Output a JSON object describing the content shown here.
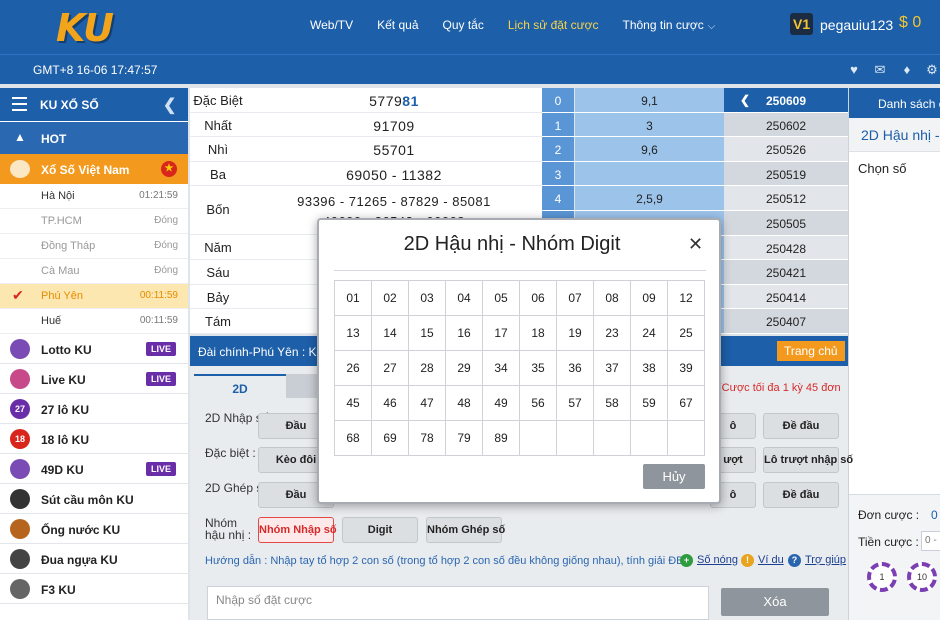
{
  "header": {
    "logo": "KU",
    "nav": [
      "Web/TV",
      "Kết quả",
      "Quy tắc",
      "Lịch sử đặt cược",
      "Thông tin cược"
    ],
    "vip": "V1",
    "username": "pegauiu123",
    "balance": "$ 0",
    "clock": "GMT+8 16-06 17:47:57",
    "accent": "#1d5fa8",
    "active_nav_color": "#f7d34a"
  },
  "sidebar": {
    "title": "KU XỔ SỐ",
    "hot": "HOT",
    "vn": "Xổ Số Việt Nam",
    "provinces": [
      {
        "name": "Hà Nội",
        "status": "01:21:59"
      },
      {
        "name": "TP.HCM",
        "status": "Đóng"
      },
      {
        "name": "Đồng Tháp",
        "status": "Đóng"
      },
      {
        "name": "Cà Mau",
        "status": "Đóng"
      },
      {
        "name": "Phú Yên",
        "status": "00:11:59"
      },
      {
        "name": "Huế",
        "status": "00:11:59"
      }
    ],
    "games": [
      {
        "name": "Lotto KU",
        "live": "LIVE",
        "icon": "lotto-icon",
        "color": "#7b4bb5"
      },
      {
        "name": "Live KU",
        "live": "LIVE",
        "icon": "live-host-icon",
        "color": "#c8498a"
      },
      {
        "name": "27 lô KU",
        "badge": "27",
        "icon": "ball-27-icon",
        "color": "#6a2da8"
      },
      {
        "name": "18 lô KU",
        "badge": "18",
        "icon": "ball-18-icon",
        "color": "#d8261c"
      },
      {
        "name": "49D KU",
        "live": "LIVE",
        "icon": "49d-icon",
        "color": "#7b4bb5"
      },
      {
        "name": "Sút cầu môn KU",
        "icon": "soccer-icon",
        "color": "#333333"
      },
      {
        "name": "Ống nước KU",
        "icon": "pipe-icon",
        "color": "#b5651d"
      },
      {
        "name": "Đua ngựa KU",
        "icon": "horse-icon",
        "color": "#444444"
      },
      {
        "name": "F3 KU",
        "icon": "f3-car-icon",
        "color": "#666666"
      }
    ]
  },
  "results": [
    {
      "label": "Đặc Biệt",
      "value": "5779",
      "value_hl": "81"
    },
    {
      "label": "Nhất",
      "value": "91709"
    },
    {
      "label": "Nhì",
      "value": "55701"
    },
    {
      "label": "Ba",
      "value": "69050 - 11382"
    },
    {
      "label": "Bốn",
      "value": "93396 - 71265 - 87829 - 85081",
      "value2": "40600 - 26542 - 00008"
    },
    {
      "label": "Năm",
      "value": ""
    },
    {
      "label": "Sáu",
      "value": ""
    },
    {
      "label": "Bảy",
      "value": ""
    },
    {
      "label": "Tám",
      "value": ""
    }
  ],
  "digits": [
    {
      "d": "0",
      "v": "9,1"
    },
    {
      "d": "1",
      "v": "3"
    },
    {
      "d": "2",
      "v": "9,6"
    },
    {
      "d": "3",
      "v": ""
    },
    {
      "d": "4",
      "v": "2,5,9"
    },
    {
      "d": "",
      "v": ""
    },
    {
      "d": "",
      "v": ""
    },
    {
      "d": "",
      "v": ""
    },
    {
      "d": "",
      "v": ""
    },
    {
      "d": "",
      "v": ""
    }
  ],
  "history": [
    "250609",
    "250602",
    "250526",
    "250519",
    "250512",
    "250505",
    "250428",
    "250421",
    "250414",
    "250407"
  ],
  "right_panel": {
    "title": "Danh sách c",
    "sub": "2D Hậu nhị -",
    "choose": "Chọn số",
    "bet_label": "Đơn cược :",
    "bet_value": "0",
    "money_label": "Tiền cược :",
    "money_value": "0 -",
    "chips": [
      "1",
      "10"
    ]
  },
  "bet": {
    "title": "Đài chính-Phú Yên : K",
    "home": "Trang chủ",
    "tab1": "2D",
    "note": "(Cược tối đa 1 kỳ 45 đơn",
    "rows": [
      {
        "label": "2D Nhập số :",
        "btn1": "Đầu",
        "btnR1": "Đề đầu",
        "btnRL": "ô"
      },
      {
        "label": "Đặc biệt :",
        "btn1": "Kèo đôi",
        "btnR1": "Lô trượt nhập số",
        "btnRL": "ượt"
      },
      {
        "label": "2D Ghép số :",
        "btn1": "Đầu",
        "btnR1": "Đề đầu",
        "btnRL": "ô"
      },
      {
        "label": "Nhóm hậu nhị :",
        "btn1": "Nhóm Nhập số",
        "btn2": "Digit",
        "btn3": "Nhóm Ghép số"
      }
    ],
    "guide": "Hướng dẫn : Nhập tay tổ hợp 2 con số (trong tổ hợp 2 con số đều không giống nhau), tính giải ĐB",
    "links": [
      "Số nóng",
      "Ví du",
      "Trợ giúp"
    ],
    "input_placeholder": "Nhập số đặt cược",
    "clear": "Xóa"
  },
  "modal": {
    "title": "2D Hậu nhị - Nhóm Digit",
    "cancel": "Hủy",
    "numbers": [
      "01",
      "02",
      "03",
      "04",
      "05",
      "06",
      "07",
      "08",
      "09",
      "12",
      "13",
      "14",
      "15",
      "16",
      "17",
      "18",
      "19",
      "23",
      "24",
      "25",
      "26",
      "27",
      "28",
      "29",
      "34",
      "35",
      "36",
      "37",
      "38",
      "39",
      "45",
      "46",
      "47",
      "48",
      "49",
      "56",
      "57",
      "58",
      "59",
      "67",
      "68",
      "69",
      "78",
      "79",
      "89"
    ]
  }
}
